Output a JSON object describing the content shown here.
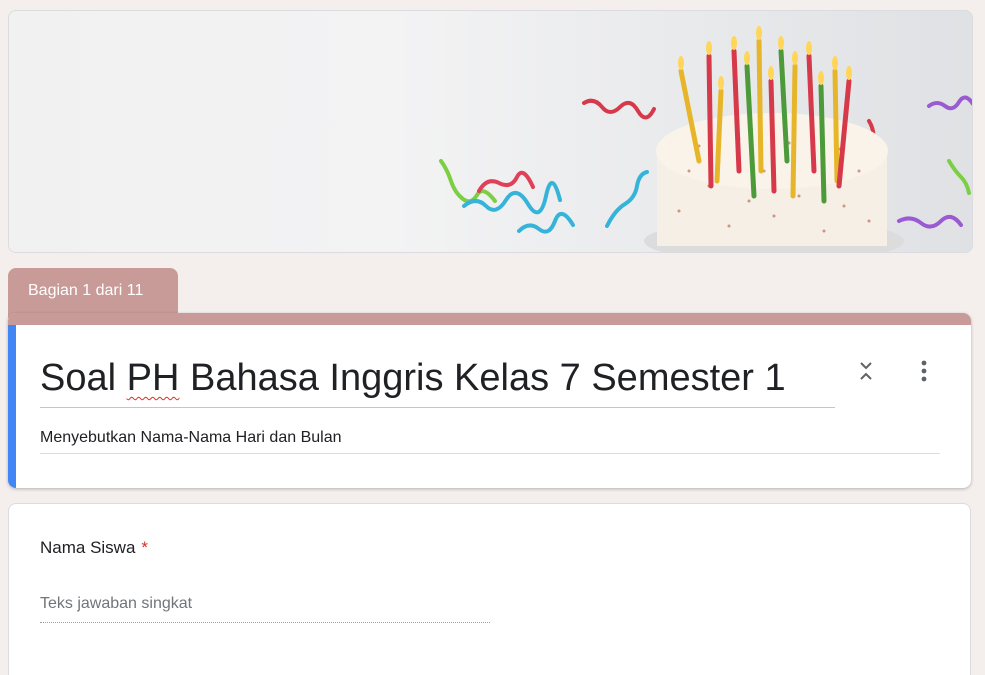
{
  "section_tab": {
    "label": "Bagian 1 dari 11",
    "color": "#c89a98"
  },
  "header": {
    "title_pre": "Soal ",
    "title_flagged": "PH",
    "title_post": " Bahasa Inggris Kelas 7 Semester 1",
    "description": "Menyebutkan Nama-Nama Hari dan Bulan",
    "accent_color": "#4285f4",
    "collapse_icon": "collapse-icon",
    "more_icon": "more-vert-icon"
  },
  "question": {
    "label": "Nama Siswa",
    "required_mark": "*",
    "placeholder": "Teks jawaban singkat"
  }
}
